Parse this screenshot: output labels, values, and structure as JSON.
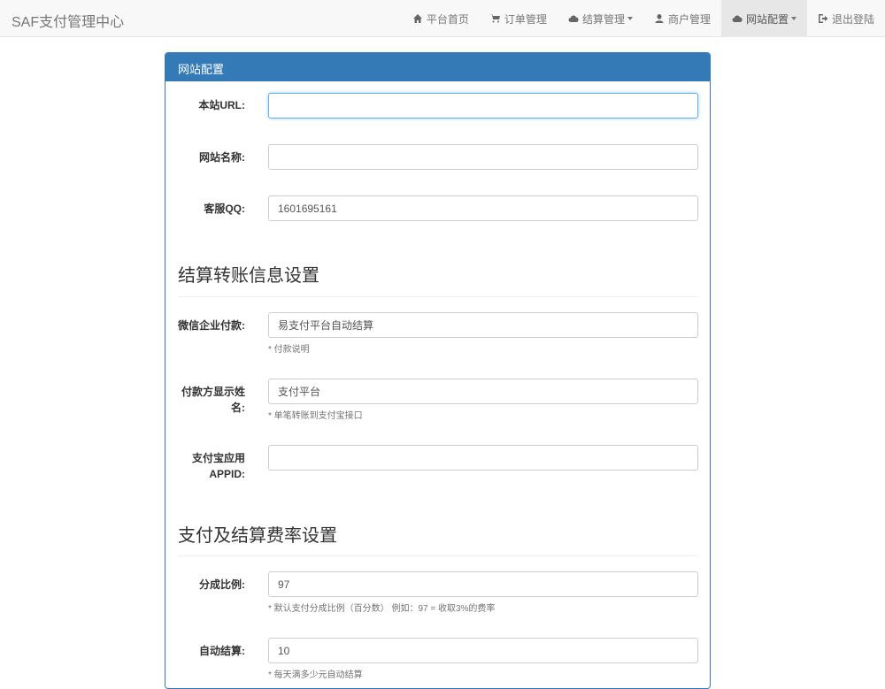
{
  "brand": "SAF支付管理中心",
  "nav": [
    {
      "label": "平台首页",
      "icon": "home-icon"
    },
    {
      "label": "订单管理",
      "icon": "cart-icon"
    },
    {
      "label": "结算管理",
      "icon": "cloud-icon",
      "dropdown": true
    },
    {
      "label": "商户管理",
      "icon": "user-icon"
    },
    {
      "label": "网站配置",
      "icon": "cloud-icon",
      "dropdown": true,
      "active": true
    },
    {
      "label": "退出登陆",
      "icon": "logout-icon"
    }
  ],
  "panel": {
    "title": "网站配置",
    "site_url": {
      "label": "本站URL:",
      "value": ""
    },
    "site_name": {
      "label": "网站名称:",
      "value": ""
    },
    "qq": {
      "label": "客服QQ:",
      "value": "1601695161"
    },
    "section_transfer": "结算转账信息设置",
    "wx_pay": {
      "label": "微信企业付款:",
      "value": "易支付平台自动结算",
      "help": "* 付款说明"
    },
    "payer_name": {
      "label": "付款方显示姓名:",
      "value": "支付平台",
      "help": "* 单笔转账到支付宝接口"
    },
    "alipay_appid": {
      "label": "支付宝应用APPID:",
      "value": ""
    },
    "section_rate": "支付及结算费率设置",
    "split_ratio": {
      "label": "分成比例:",
      "value": "97",
      "help": "* 默认支付分成比例（百分数） 例如：97 = 收取3%的费率"
    },
    "auto_settle": {
      "label": "自动结算:",
      "value": "10",
      "help": "* 每天满多少元自动结算"
    }
  },
  "colors": {
    "primary": "#337ab7",
    "navbar_bg": "#f8f8f8"
  }
}
